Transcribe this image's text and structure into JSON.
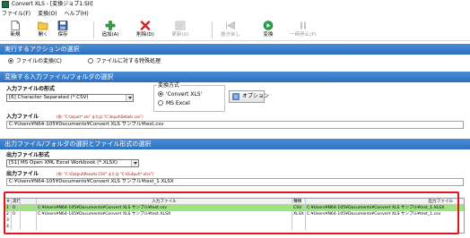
{
  "window": {
    "title": "Convert XLS - [変換ジョブ1.SII]"
  },
  "menu": {
    "items": [
      "ファイル(F)",
      "変換(O)",
      "ヘルプ(H)"
    ]
  },
  "toolbar": {
    "buttons": [
      {
        "label": "新規",
        "icon": "new-file-icon",
        "enabled": true
      },
      {
        "label": "開く",
        "icon": "open-folder-icon",
        "enabled": true
      },
      {
        "label": "保存",
        "icon": "save-icon",
        "enabled": true
      },
      {
        "label": "追加(A)",
        "icon": "add-plus-icon",
        "enabled": true
      },
      {
        "label": "削除(D)",
        "icon": "delete-x-icon",
        "enabled": true
      },
      {
        "label": "更新(U)",
        "icon": "update-icon",
        "enabled": false
      },
      {
        "label": "巻き戻し",
        "icon": "rewind-icon",
        "enabled": false
      },
      {
        "label": "変換",
        "icon": "convert-play-icon",
        "enabled": true
      },
      {
        "label": "一時停止(P)",
        "icon": "pause-icon",
        "enabled": false
      }
    ]
  },
  "action_section": {
    "title": "実行するアクションの選択",
    "options": [
      {
        "label": "ファイルの変換(C)",
        "selected": true
      },
      {
        "label": "ファイルに対する特殊処理",
        "selected": false
      }
    ]
  },
  "input_section": {
    "title": "変換する入力ファイル/フォルダの選択",
    "format_label": "入力ファイルの形式",
    "format_value": "[6] Character Separated (*.CSV)",
    "method_group_title": "変換方式",
    "method_options": [
      {
        "label": "'Convert XLS'",
        "selected": true
      },
      {
        "label": "MS Excel",
        "selected": false
      }
    ],
    "options_button": "オプション",
    "file_label": "入力ファイル",
    "file_hint": "(例: \"C:\\Input\\*.xls\" または \"C:\\Input\\Details.csv\")",
    "file_value": "C:¥Users¥N64-105¥Documents¥Convert XLS サンプル¥test.csv"
  },
  "output_section": {
    "title": "出力ファイル/フォルダの選択とファイル形式の選択",
    "format_label": "出力ファイル形式",
    "format_value": "[51] MS Open XML Excel Workbook (*.XLSX)",
    "file_label": "出力ファイル",
    "file_hint": "(例: \"C:\\Output\\Results.CSV\" または \"C:\\Output\\*.xlsx\")",
    "file_value": "C:¥Users¥N64-105¥Documents¥Convert XLS サンプル¥test_1.XLSX"
  },
  "job_grid": {
    "columns": [
      "#",
      "実行",
      "入力ファイル",
      "種類",
      "出力ファイル"
    ],
    "rows": [
      {
        "num": "1",
        "run": "0",
        "input": "C:¥Users¥N64-105¥Documents¥Convert XLS サンプル¥test.csv",
        "type": "CSV",
        "output": "C:¥Users¥N64-105¥Documents¥Convert XLS サンプル¥test_1.XLSX",
        "selected": true
      },
      {
        "num": "2",
        "run": "0",
        "input": "C:¥Users¥N64-105¥Documents¥Convert XLS サンプル¥test.XLSX",
        "type": "XLSX",
        "output": "C:¥Users¥N64-105¥Documents¥Convert XLS サンプル¥test_1.csv",
        "selected": false
      },
      {
        "num": "3",
        "run": "",
        "input": "",
        "type": "",
        "output": "",
        "selected": false
      },
      {
        "num": "4",
        "run": "",
        "input": "",
        "type": "",
        "output": "",
        "selected": false
      }
    ]
  },
  "colors": {
    "section_bar": "#2d6fbf",
    "selected_row": "#9be57d",
    "highlight_box": "#e0141e"
  }
}
